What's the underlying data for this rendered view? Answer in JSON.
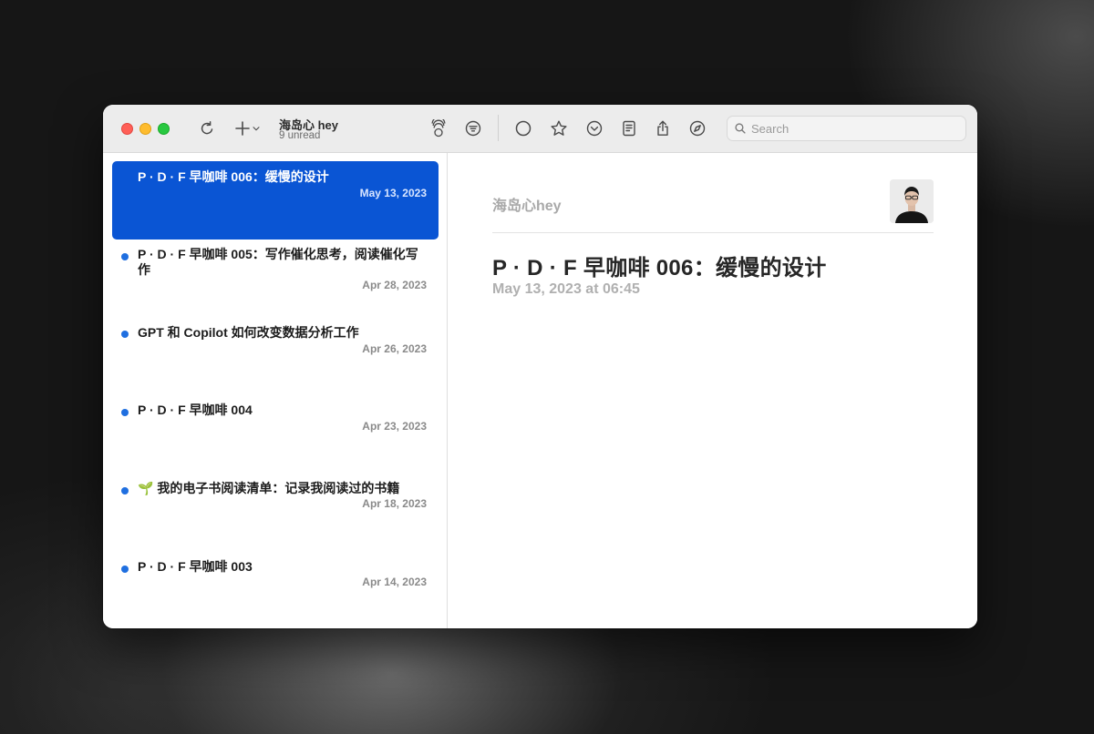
{
  "feed": {
    "title": "海岛心 hey",
    "unread": "9 unread"
  },
  "search": {
    "placeholder": "Search"
  },
  "icons": {
    "refresh": "refresh-icon",
    "add": "plus-icon",
    "add_menu": "chevron-down-icon",
    "reader_view": "reader-view-icon",
    "filter": "filter-icon",
    "mark_read": "circle-icon",
    "star": "star-icon",
    "next_unread": "chevron-circle-down-icon",
    "article_extractor": "document-icon",
    "share": "share-icon",
    "open_browser": "compass-icon",
    "search": "magnifier-icon"
  },
  "colors": {
    "accent": "#0a55d4",
    "unread_dot": "#1f6fe0"
  },
  "articles": [
    {
      "title": "P · D · F 早咖啡 006：缓慢的设计",
      "date": "May 13, 2023",
      "selected": true,
      "unread": false
    },
    {
      "title": "P · D · F 早咖啡 005：写作催化思考，阅读催化写作",
      "date": "Apr 28, 2023",
      "selected": false,
      "unread": true
    },
    {
      "title": "GPT 和 Copilot 如何改变数据分析工作",
      "date": "Apr 26, 2023",
      "selected": false,
      "unread": true
    },
    {
      "title": "P · D · F 早咖啡 004",
      "date": "Apr 23, 2023",
      "selected": false,
      "unread": true
    },
    {
      "title": "🌱 我的电子书阅读清单：记录我阅读过的书籍",
      "date": "Apr 18, 2023",
      "selected": false,
      "unread": true
    },
    {
      "title": "P · D · F 早咖啡 003",
      "date": "Apr 14, 2023",
      "selected": false,
      "unread": true
    }
  ],
  "reader": {
    "author": "海岛心hey",
    "title": "P · D · F 早咖啡 006：缓慢的设计",
    "datetime": "May 13, 2023 at 06:45"
  }
}
